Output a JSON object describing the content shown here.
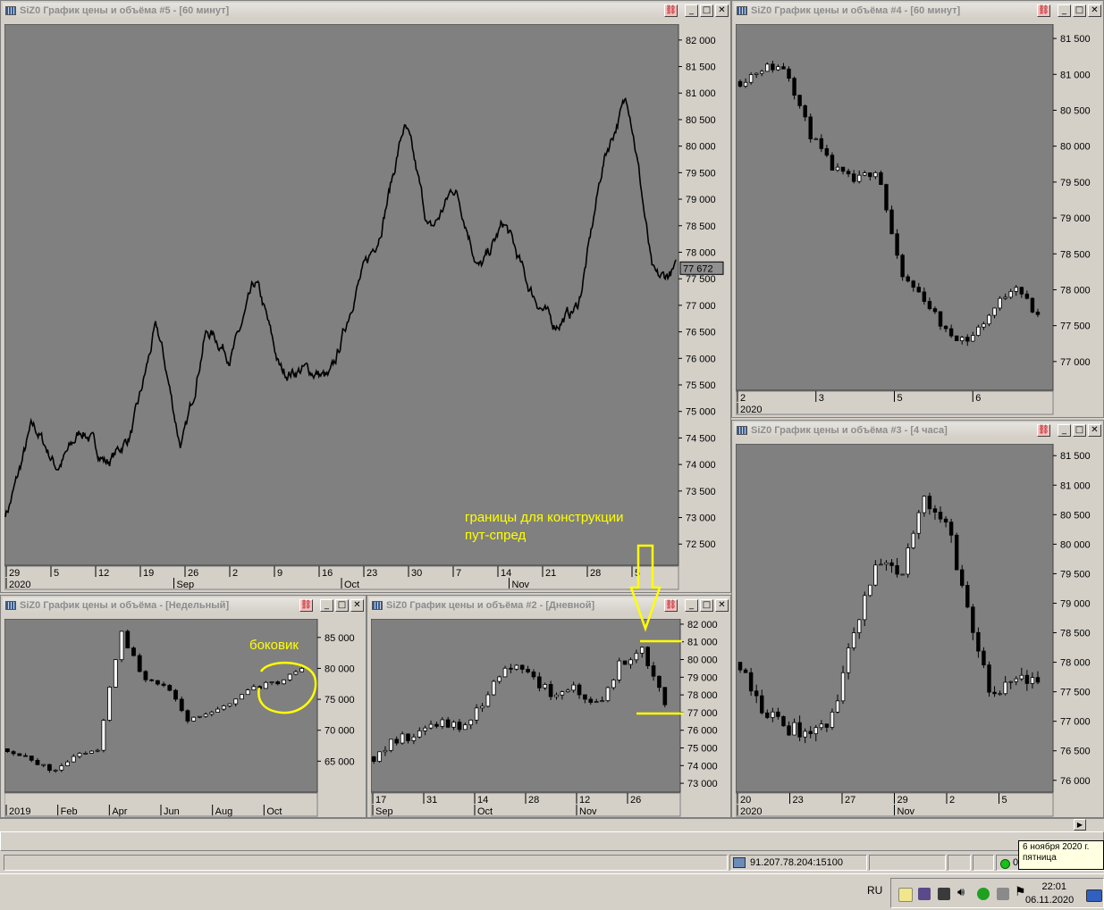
{
  "windows": {
    "w5": {
      "title": "SiZ0 График цены и объёма #5 - [60 минут]",
      "price_badge": "77 672",
      "yticks": [
        "82 000",
        "81 500",
        "81 000",
        "80 500",
        "80 000",
        "79 500",
        "79 000",
        "78 500",
        "78 000",
        "77 500",
        "77 000",
        "76 500",
        "76 000",
        "75 500",
        "75 000",
        "74 500",
        "74 000",
        "73 500",
        "73 000",
        "72 500"
      ],
      "xticks": [
        "29",
        "5",
        "12",
        "19",
        "26",
        "2",
        "9",
        "16",
        "23",
        "30",
        "7",
        "14",
        "21",
        "28",
        "5"
      ],
      "xlabels": [
        "2020",
        "Sep",
        "Oct",
        "Nov"
      ]
    },
    "w4": {
      "title": "SiZ0 График цены и объёма #4 - [60 минут]",
      "yticks": [
        "81 500",
        "81 000",
        "80 500",
        "80 000",
        "79 500",
        "79 000",
        "78 500",
        "78 000",
        "77 500",
        "77 000"
      ],
      "xticks": [
        "2",
        "3",
        "5",
        "6"
      ],
      "xlabels": [
        "2020"
      ]
    },
    "w3": {
      "title": "SiZ0 График цены и объёма #3 - [4 часа]",
      "yticks": [
        "81 500",
        "81 000",
        "80 500",
        "80 000",
        "79 500",
        "79 000",
        "78 500",
        "78 000",
        "77 500",
        "77 000",
        "76 500",
        "76 000"
      ],
      "xticks": [
        "20",
        "23",
        "27",
        "29",
        "2",
        "5"
      ],
      "xlabels": [
        "2020",
        "Nov"
      ]
    },
    "wweek": {
      "title": "SiZ0 График цены и объёма - [Недельный]",
      "yticks": [
        "85 000",
        "80 000",
        "75 000",
        "70 000",
        "65 000"
      ],
      "xticks": [],
      "xlabels": [
        "2019",
        "Feb",
        "Apr",
        "Jun",
        "Aug",
        "Oct"
      ]
    },
    "w2": {
      "title": "SiZ0 График цены и объёма #2 - [Дневной]",
      "yticks": [
        "82 000",
        "81 000",
        "80 000",
        "79 000",
        "78 000",
        "77 000",
        "76 000",
        "75 000",
        "74 000",
        "73 000"
      ],
      "xticks": [
        "17",
        "31",
        "14",
        "28",
        "12",
        "26"
      ],
      "xlabels": [
        "Sep",
        "Oct",
        "Nov"
      ]
    }
  },
  "annotations": {
    "putspread": "границы для конструкции\nпут-спред",
    "sideways": "боковик"
  },
  "status": {
    "connection": "91.207.78.204:15100",
    "online_glyph": "0"
  },
  "taskbar": {
    "lang": "RU",
    "time": "22:01",
    "date": "06.11.2020"
  },
  "tooltip": {
    "line1": "6 ноября 2020 г.",
    "line2": "пятница"
  },
  "colors": {
    "chart_bg": "#808080",
    "grid": "#8c8c8c",
    "candle": "#000000",
    "up_body": "#ffffff",
    "annotation": "#ffff00"
  },
  "chart_data": [
    {
      "type": "line",
      "title": "SiZ0 График цены и объёма #5 - [60 минут]",
      "ylim": [
        72100,
        82300
      ],
      "x": [
        "2020-08-28",
        "2020-08-31",
        "2020-09-03",
        "2020-09-05",
        "2020-09-08",
        "2020-09-11",
        "2020-09-14",
        "2020-09-17",
        "2020-09-18",
        "2020-09-21",
        "2020-09-23",
        "2020-09-25",
        "2020-09-27",
        "2020-09-30",
        "2020-10-02",
        "2020-10-05",
        "2020-10-08",
        "2020-10-12",
        "2020-10-14",
        "2020-10-16",
        "2020-10-20",
        "2020-10-23",
        "2020-10-26",
        "2020-10-28",
        "2020-10-30",
        "2020-11-02",
        "2020-11-04",
        "2020-11-06"
      ],
      "series": [
        {
          "values": [
            73100,
            74800,
            73900,
            74700,
            74000,
            74600,
            76700,
            74200,
            76600,
            76000,
            77500,
            75700,
            75800,
            75600,
            77300,
            78400,
            80500,
            78300,
            79300,
            77600,
            78600,
            77300,
            76600,
            77000,
            79800,
            81000,
            77400,
            77700
          ]
        }
      ]
    },
    {
      "type": "candlestick",
      "title": "SiZ0 График цены и объёма #4 - [60 минут]",
      "ylim": [
        76600,
        81700
      ],
      "x": [
        "2",
        "3",
        "5",
        "6"
      ],
      "close": [
        80900,
        81100,
        81100,
        80200,
        79700,
        79500,
        79700,
        78200,
        77900,
        77400,
        77300,
        77700,
        78100,
        77600
      ]
    },
    {
      "type": "candlestick",
      "title": "SiZ0 График цены и объёма #3 - [4 часа]",
      "ylim": [
        75800,
        81700
      ],
      "x": [
        "20",
        "23",
        "27",
        "29",
        "2",
        "5"
      ],
      "close": [
        78000,
        77200,
        76900,
        76800,
        77000,
        78600,
        79700,
        79400,
        80800,
        80400,
        78800,
        77300,
        77700,
        77600
      ]
    },
    {
      "type": "candlestick",
      "title": "SiZ0 График цены и объёма - [Недельный]",
      "ylim": [
        60000,
        88000
      ],
      "x": [
        "2019",
        "Feb",
        "Apr",
        "Jun",
        "Aug",
        "Oct"
      ],
      "close": [
        67000,
        65000,
        63500,
        66000,
        67000,
        86000,
        78500,
        77000,
        71500,
        72500,
        75000,
        77000,
        78000,
        80000
      ]
    },
    {
      "type": "candlestick",
      "title": "SiZ0 График цены и объёма #2 - [Дневной]",
      "ylim": [
        72500,
        82300
      ],
      "x": [
        "17",
        "31",
        "14",
        "28",
        "12",
        "26"
      ],
      "close": [
        74500,
        75500,
        75800,
        76500,
        76000,
        77800,
        79800,
        79000,
        78000,
        78400,
        77300,
        79800,
        80500,
        77500
      ]
    }
  ]
}
